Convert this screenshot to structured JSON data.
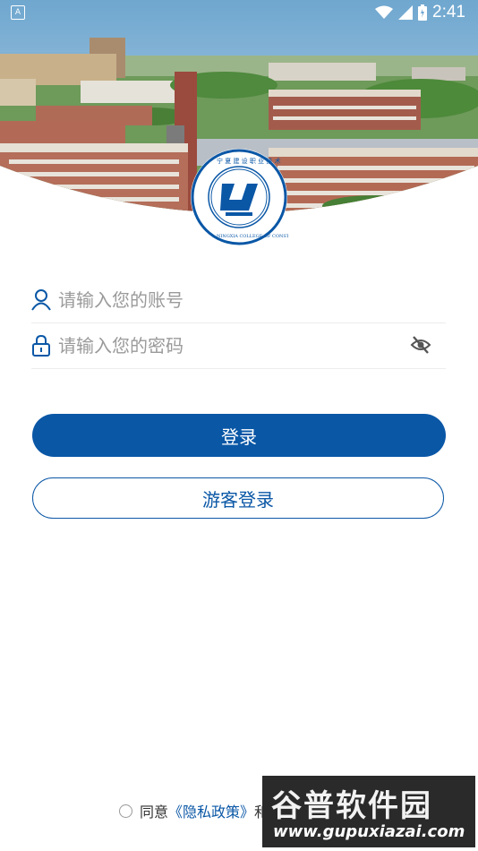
{
  "status_bar": {
    "notification_icon": "A",
    "time": "2:41",
    "icons": [
      "wifi-icon",
      "cellular-signal-icon",
      "battery-icon"
    ]
  },
  "hero": {
    "image": "campus-aerial-photo",
    "logo": {
      "seal_text_top": "宁夏建设职业技术学院",
      "seal_text_bottom": "NINGXIA COLLEGE OF CONSTRUCTION",
      "colors": {
        "primary": "#0a57a6",
        "background": "#ffffff"
      }
    }
  },
  "login_form": {
    "account": {
      "placeholder": "请输入您的账号",
      "value": "",
      "icon": "user-icon"
    },
    "password": {
      "placeholder": "请输入您的密码",
      "value": "",
      "icon": "lock-icon",
      "toggle_icon": "eye-off-icon"
    },
    "login_button": "登录",
    "guest_button": "游客登录"
  },
  "agreement": {
    "checked": false,
    "prefix": "同意",
    "privacy_link": "《隐私政策》",
    "connector": "和"
  },
  "watermark": {
    "brand": "谷普软件园",
    "url": "www.gupuxiazai.com"
  },
  "colors": {
    "accent": "#0a57a6",
    "placeholder": "#9a9a9a",
    "divider": "#ececec"
  }
}
